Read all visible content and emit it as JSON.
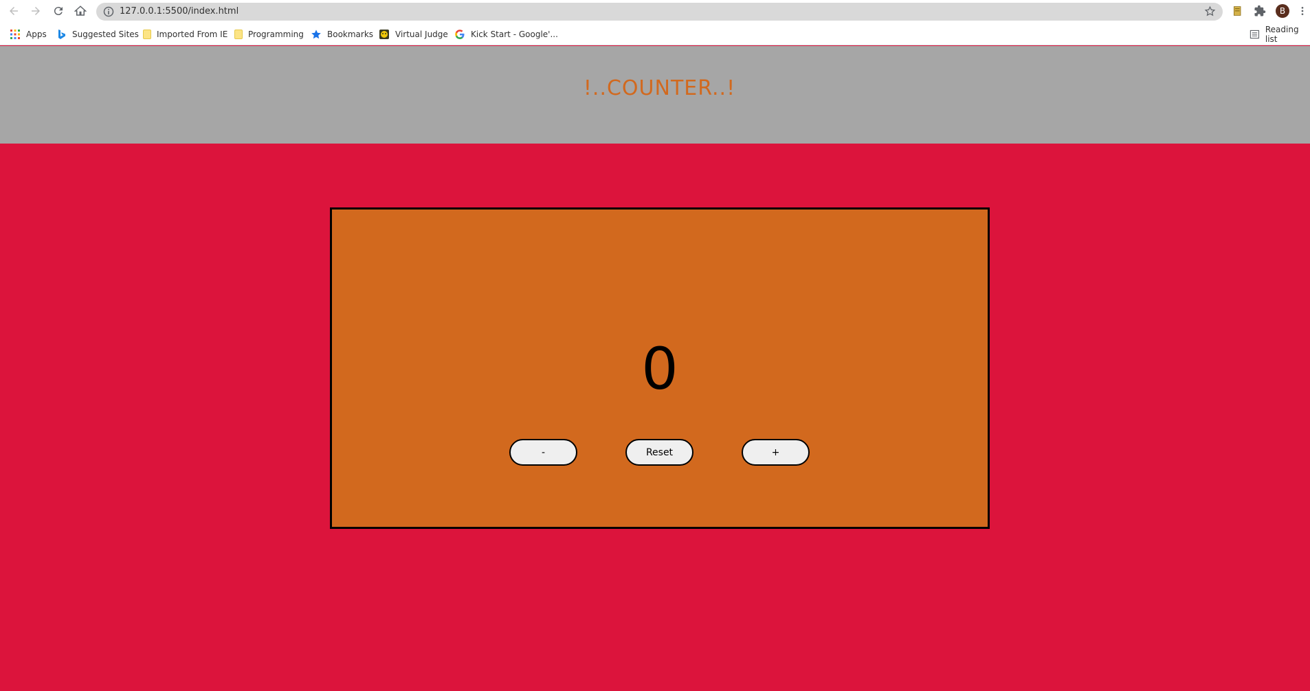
{
  "browser": {
    "url": "127.0.0.1:5500/index.html",
    "profile_initial": "B",
    "bookmarks": [
      {
        "label": "Apps",
        "icon": "apps-grid-icon"
      },
      {
        "label": "Suggested Sites",
        "icon": "bing-icon"
      },
      {
        "label": "Imported From IE",
        "icon": "folder-icon"
      },
      {
        "label": "Programming",
        "icon": "folder-icon"
      },
      {
        "label": "Bookmarks",
        "icon": "star-icon"
      },
      {
        "label": "Virtual Judge",
        "icon": "virtual-judge-icon"
      },
      {
        "label": "Kick Start - Google'...",
        "icon": "google-icon"
      }
    ],
    "reading_list": "Reading list"
  },
  "page": {
    "title": "!..COUNTER..!",
    "count": "0",
    "buttons": {
      "decrement": "-",
      "reset": "Reset",
      "increment": "+"
    }
  },
  "colors": {
    "background": "#dc143c",
    "header": "#a6a6a6",
    "title": "#d2691e",
    "counter_box": "#d2691e"
  }
}
